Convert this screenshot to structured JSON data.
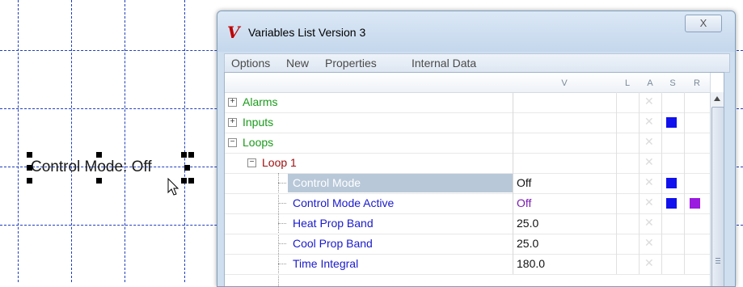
{
  "canvas": {
    "label_text": "Control Mode: Off"
  },
  "dialog": {
    "app_icon": "V",
    "title": "Variables List Version 3",
    "close_glyph": "X",
    "menu": [
      "Options",
      "New",
      "Properties",
      "Internal Data"
    ],
    "columns": {
      "value": "V",
      "l": "L",
      "a": "A",
      "s": "S",
      "r": "R"
    },
    "rows": [
      {
        "name": "Alarms",
        "value": ""
      },
      {
        "name": "Inputs",
        "value": ""
      },
      {
        "name": "Loops",
        "value": ""
      },
      {
        "name": "Loop 1",
        "value": ""
      },
      {
        "name": "Control Mode",
        "value": "Off"
      },
      {
        "name": "Control Mode Active",
        "value": "Off"
      },
      {
        "name": "Heat Prop Band",
        "value": "25.0"
      },
      {
        "name": "Cool Prop Band",
        "value": "25.0"
      },
      {
        "name": "Time Integral",
        "value": "180.0"
      }
    ]
  },
  "colors": {
    "green_text": "#1a9a1a",
    "loop_text": "#a01010",
    "blue_text": "#1a1acc",
    "purple_text": "#7a1ab0",
    "selected_bg": "#b8c8d8",
    "marker_green": "#22cc22",
    "marker_blue": "#1111ee",
    "marker_purple": "#9a1ae0"
  },
  "icons": [
    "app-logo-icon",
    "close-icon",
    "expand-plus-icon",
    "collapse-minus-icon",
    "mouse-cursor-icon",
    "scroll-up-arrow-icon"
  ]
}
